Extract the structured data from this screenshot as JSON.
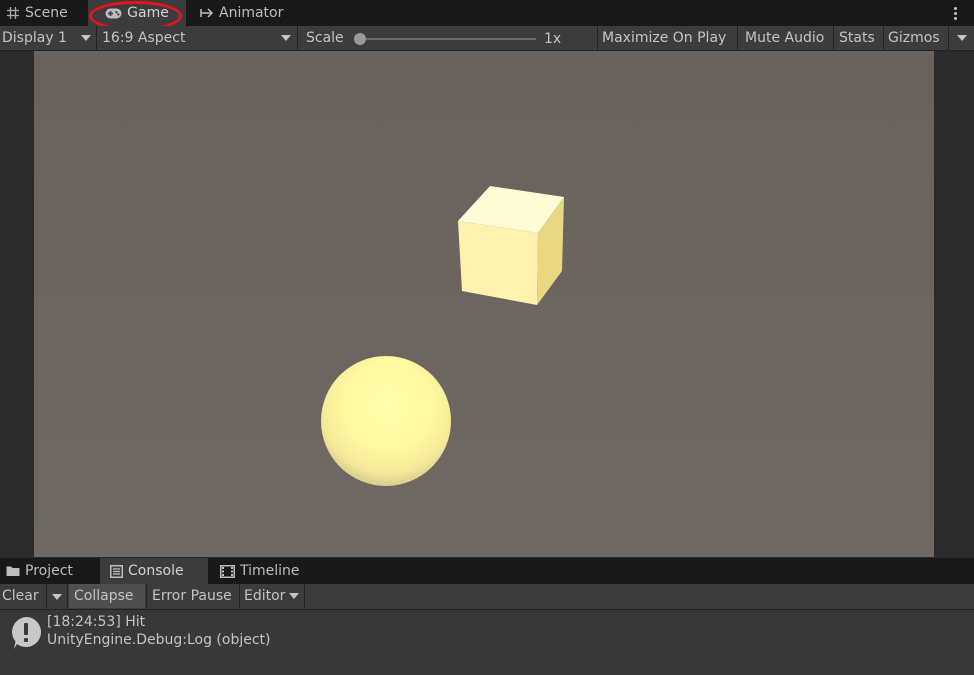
{
  "top_tabs": [
    {
      "label": "Scene",
      "icon": "grid-icon"
    },
    {
      "label": "Game",
      "icon": "gamepad-icon"
    },
    {
      "label": "Animator",
      "icon": "animator-icon"
    }
  ],
  "toolbar": {
    "display": "Display 1",
    "aspect": "16:9 Aspect",
    "scale_label": "Scale",
    "scale_value": "1x",
    "scale_level": 0.0,
    "maximize": "Maximize On Play",
    "mute": "Mute Audio",
    "stats": "Stats",
    "gizmos": "Gizmos"
  },
  "scene": {
    "background_color": "#6d6661",
    "objects": [
      "cube",
      "sphere"
    ],
    "object_color": "#fff3a8"
  },
  "bottom_tabs": [
    {
      "label": "Project",
      "icon": "folder-icon"
    },
    {
      "label": "Console",
      "icon": "console-icon"
    },
    {
      "label": "Timeline",
      "icon": "timeline-icon"
    }
  ],
  "console_toolbar": {
    "clear": "Clear",
    "collapse": "Collapse",
    "error_pause": "Error Pause",
    "editor": "Editor"
  },
  "log": {
    "line1": "[18:24:53] Hit",
    "line2": "UnityEngine.Debug:Log (object)"
  },
  "highlight_color": "#e8131b"
}
